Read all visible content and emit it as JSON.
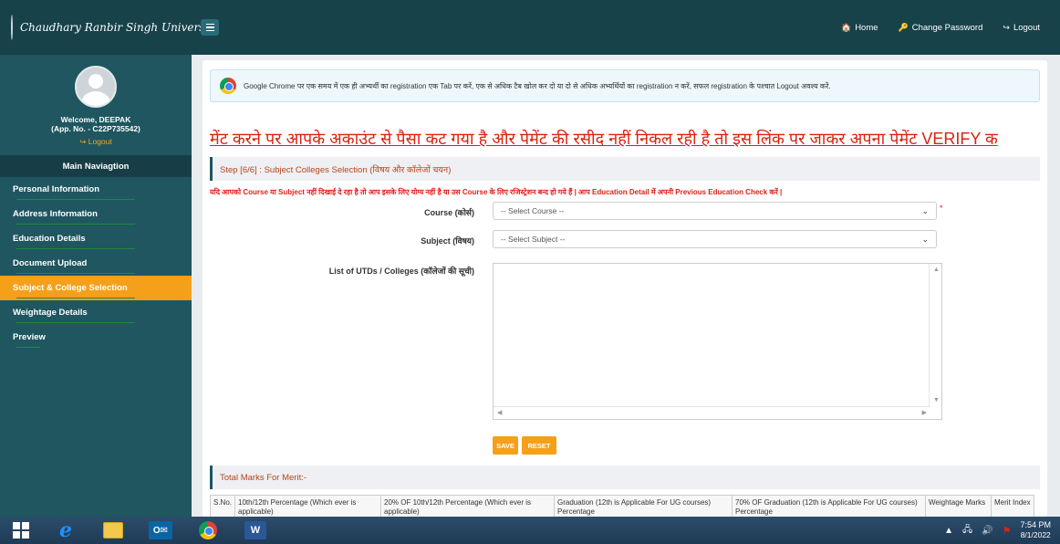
{
  "header": {
    "brand": "Chaudhary Ranbir Singh University",
    "links": [
      {
        "icon": "home-icon",
        "glyph": "🏠",
        "label": "Home"
      },
      {
        "icon": "key-icon",
        "glyph": "🔑",
        "label": "Change Password"
      },
      {
        "icon": "logout-icon",
        "glyph": "↪",
        "label": "Logout"
      }
    ]
  },
  "sidebar": {
    "welcome": "Welcome, DEEPAK",
    "app_no": "(App. No. - C22P735542)",
    "logout": "Logout",
    "nav_title": "Main Naviagtion",
    "items": [
      {
        "label": "Personal Information"
      },
      {
        "label": "Address Information"
      },
      {
        "label": "Education Details"
      },
      {
        "label": "Document Upload"
      },
      {
        "label": "Subject & College Selection",
        "active": true
      },
      {
        "label": "Weightage Details"
      },
      {
        "label": "Preview"
      }
    ]
  },
  "main": {
    "notice": "Google Chrome पर एक समय में एक ही अभ्यर्थी का registration एक Tab पर करें, एक से अधिक टैब खोल कर दो या दो से अधिक अभ्यर्थियों का registration न करें, सफल registration के पश्चात Logout अवश्य करें.",
    "marquee": "मेंट करने पर आपके अकाउंट से पैसा कट गया है और पेमेंट की रसीद नहीं निकल रही है तो इस लिंक पर जाकर अपना पेमेंट VERIFY क",
    "step_title": "Step [6/6] : Subject Colleges Selection (विषय और कॉलेजों चयन)",
    "warning": "यदि आपको Course या Subject नहीं दिखाई दे रहा है तो आप इसके लिए योग्य नहीं है या उस Course के लिए रजिस्ट्रेशन बन्द हो गये हैं | आप Education Detail में अपनी Previous Education Check करें |",
    "course_label": "Course (कोर्स)",
    "course_value": "-- Select Course --",
    "subject_label": "Subject (विषय)",
    "subject_value": "-- Select Subject --",
    "list_label": "List of UTDs / Colleges (कॉलेजों की सूची)",
    "save_label": "SAVE",
    "reset_label": "RESET",
    "marks_title": "Total Marks For Merit:-",
    "table_headers": [
      "S.No.",
      "10th/12th Percentage (Which ever is applicable)",
      "20% OF 10th/12th Percentage (Which ever is applicable)",
      "Graduation (12th is Applicable For UG courses) Percentage",
      "70% OF Graduation (12th is Applicable For UG courses) Percentage",
      "Weightage Marks",
      "Merit Index"
    ]
  },
  "taskbar": {
    "time": "7:54 PM",
    "date": "8/1/2022"
  }
}
